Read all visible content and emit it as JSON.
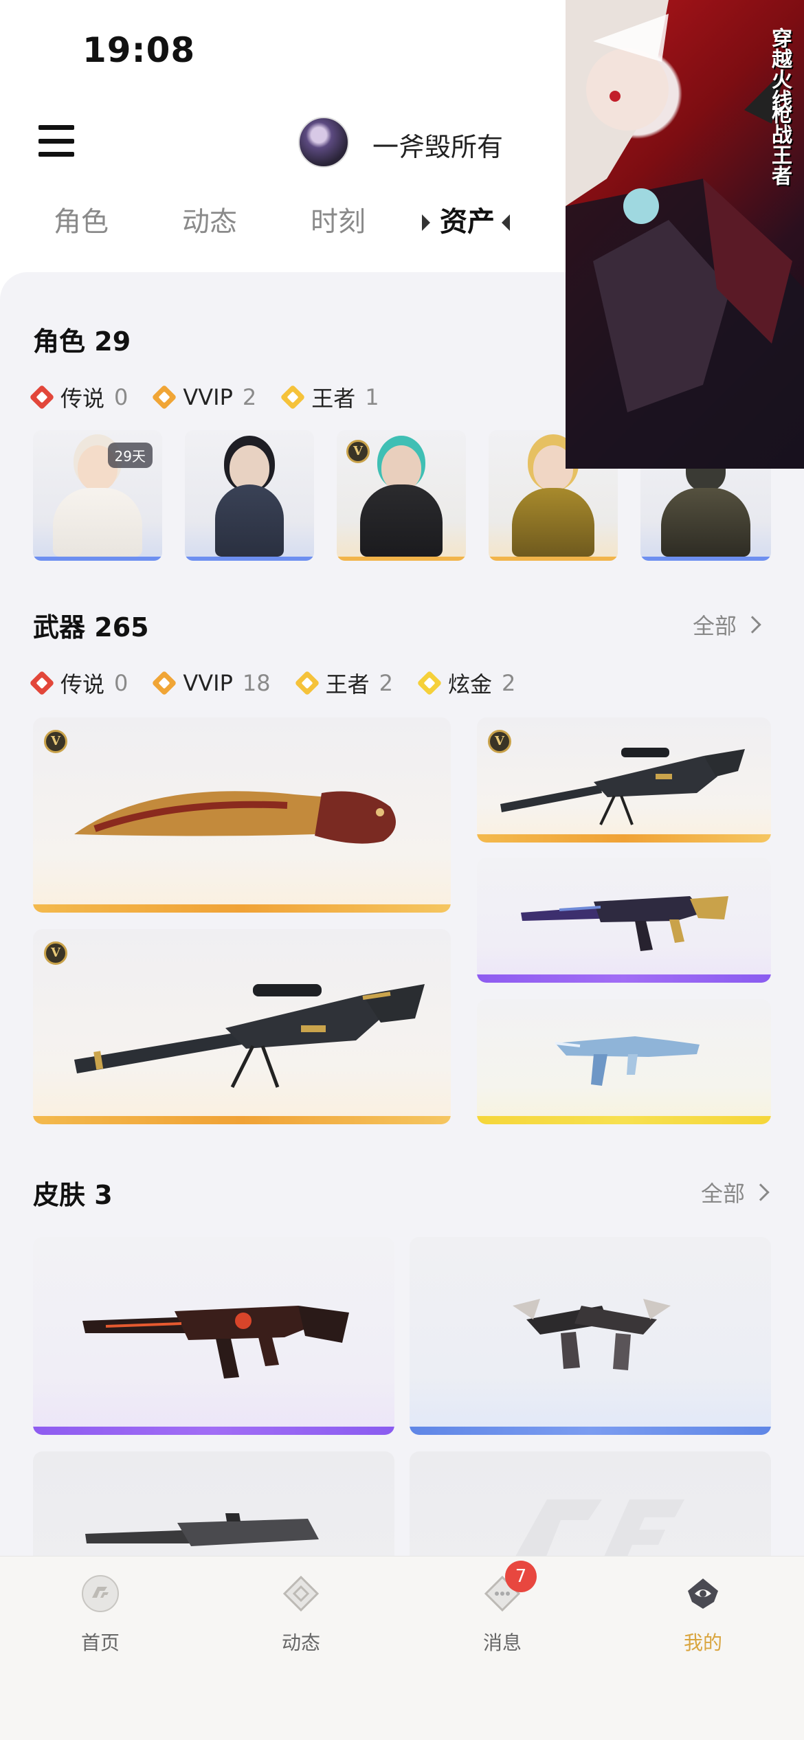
{
  "status_bar": {
    "time": "19:08"
  },
  "header": {
    "username": "一斧毁所有"
  },
  "tabs": [
    {
      "label": "角色"
    },
    {
      "label": "动态"
    },
    {
      "label": "时刻"
    },
    {
      "label": "资产",
      "active": true
    }
  ],
  "roles": {
    "title": "角色",
    "count": "29",
    "rarities": [
      {
        "label": "传说",
        "count": "0",
        "color": "#e2463a"
      },
      {
        "label": "VVIP",
        "count": "2",
        "color": "#f0a536"
      },
      {
        "label": "王者",
        "count": "1",
        "color": "#f5c23a"
      }
    ],
    "cards": [
      {
        "days": "29天",
        "bar_color": "#6d8ff0"
      },
      {
        "bar_color": "#6d8ff0"
      },
      {
        "v_badge": "V",
        "bar_color": "#f2b44a"
      },
      {
        "bar_color": "#f2b44a"
      },
      {
        "bar_color": "#6d8ff0"
      }
    ]
  },
  "weapons": {
    "title": "武器",
    "count": "265",
    "see_all": "全部",
    "rarities": [
      {
        "label": "传说",
        "count": "0",
        "color": "#e2463a"
      },
      {
        "label": "VVIP",
        "count": "18",
        "color": "#f0a536"
      },
      {
        "label": "王者",
        "count": "2",
        "color": "#f5c23a"
      },
      {
        "label": "炫金",
        "count": "2",
        "color": "#f5d03a"
      }
    ],
    "badges": [
      "V",
      "V",
      "V"
    ]
  },
  "skins": {
    "title": "皮肤",
    "count": "3",
    "see_all": "全部"
  },
  "bottom_nav": [
    {
      "label": "首页",
      "icon": "home-icon"
    },
    {
      "label": "动态",
      "icon": "feed-icon"
    },
    {
      "label": "消息",
      "icon": "message-icon",
      "badge": "7"
    },
    {
      "label": "我的",
      "icon": "profile-icon",
      "active": true
    }
  ],
  "colors": {
    "accent": "#d9a53f",
    "badge_red": "#e8473f"
  }
}
